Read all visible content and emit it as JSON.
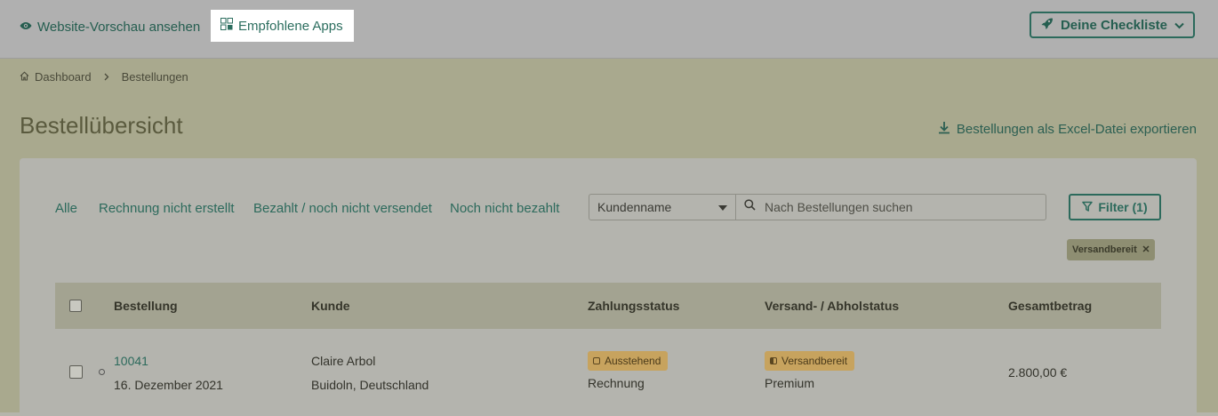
{
  "topbar": {
    "preview_label": "Website-Vorschau ansehen",
    "apps_label": "Empfohlene Apps",
    "checklist_label": "Deine Checkliste"
  },
  "breadcrumb": {
    "home": "Dashboard",
    "current": "Bestellungen"
  },
  "page": {
    "title": "Bestellübersicht",
    "export_label": "Bestellungen als Excel-Datei exportieren"
  },
  "tabs": [
    "Alle",
    "Rechnung nicht erstellt",
    "Bezahlt / noch nicht versendet",
    "Noch nicht bezahlt"
  ],
  "search": {
    "select_value": "Kundenname",
    "placeholder": "Nach Bestellungen suchen"
  },
  "filter": {
    "label": "Filter (1)",
    "chip": "Versandbereit"
  },
  "table": {
    "headers": [
      "Bestellung",
      "Kunde",
      "Zahlungsstatus",
      "Versand- / Abholstatus",
      "Gesamtbetrag"
    ],
    "rows": [
      {
        "order_no": "10041",
        "date": "16. Dezember 2021",
        "customer": "Claire Arbol",
        "location": "Buidoln, Deutschland",
        "payment_badge": "Ausstehend",
        "payment_method": "Rechnung",
        "shipping_badge": "Versandbereit",
        "shipping_method": "Premium",
        "total": "2.800,00 €"
      }
    ]
  },
  "colors": {
    "accent": "#2c6a5c",
    "badge": "#c7a35e"
  }
}
